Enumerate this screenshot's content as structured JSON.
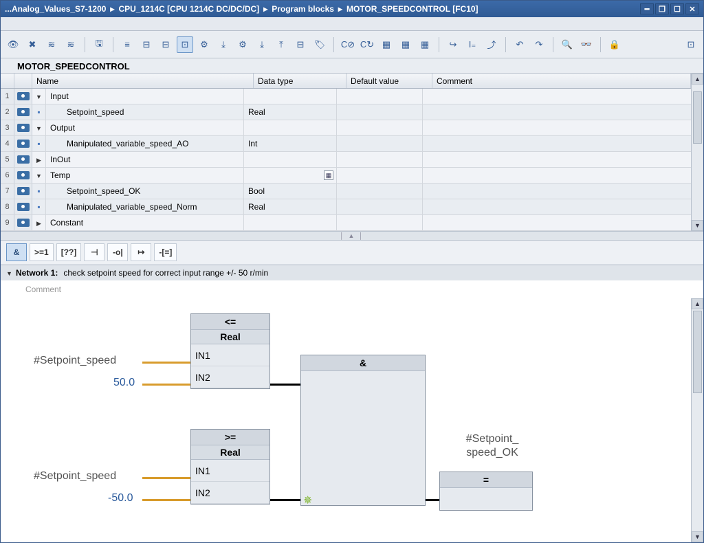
{
  "title": {
    "p1": "...Analog_Values_S7-1200",
    "p2": "CPU_1214C [CPU 1214C DC/DC/DC]",
    "p3": "Program blocks",
    "p4": "MOTOR_SPEEDCONTROL [FC10]"
  },
  "block_name": "MOTOR_SPEEDCONTROL",
  "grid": {
    "headers": {
      "name": "Name",
      "type": "Data type",
      "def": "Default value",
      "comment": "Comment"
    },
    "rows": [
      {
        "n": "1",
        "exp": "down",
        "name": "Input",
        "type": "",
        "section": true
      },
      {
        "n": "2",
        "exp": "dot",
        "name": "Setpoint_speed",
        "type": "Real",
        "indent": true
      },
      {
        "n": "3",
        "exp": "down",
        "name": "Output",
        "type": "",
        "section": true
      },
      {
        "n": "4",
        "exp": "dot",
        "name": "Manipulated_variable_speed_AO",
        "type": "Int",
        "indent": true
      },
      {
        "n": "5",
        "exp": "right",
        "name": "InOut",
        "type": "",
        "section": true
      },
      {
        "n": "6",
        "exp": "down",
        "name": "Temp",
        "type": "",
        "section": true,
        "dd": true
      },
      {
        "n": "7",
        "exp": "dot",
        "name": "Setpoint_speed_OK",
        "type": "Bool",
        "indent": true
      },
      {
        "n": "8",
        "exp": "dot",
        "name": "Manipulated_variable_speed_Norm",
        "type": "Real",
        "indent": true
      },
      {
        "n": "9",
        "exp": "right",
        "name": "Constant",
        "type": "",
        "section": true
      }
    ]
  },
  "fbdbar": [
    "&",
    ">=1",
    "[??]",
    "⊣",
    "-o|",
    "↦",
    "-[=]"
  ],
  "network": {
    "label": "Network 1:",
    "title": "check setpoint speed for correct input range +/- 50 r/min",
    "comment": "Comment"
  },
  "fbd": {
    "cmp1": {
      "op": "<=",
      "type": "Real",
      "in1": "IN1",
      "in2": "IN2",
      "sig1": "#Setpoint_speed",
      "val2": "50.0"
    },
    "cmp2": {
      "op": ">=",
      "type": "Real",
      "in1": "IN1",
      "in2": "IN2",
      "sig1": "#Setpoint_speed",
      "val2": "-50.0"
    },
    "and": {
      "op": "&"
    },
    "eq": {
      "op": "=",
      "out": "#Setpoint_",
      "out2": "speed_OK"
    }
  }
}
